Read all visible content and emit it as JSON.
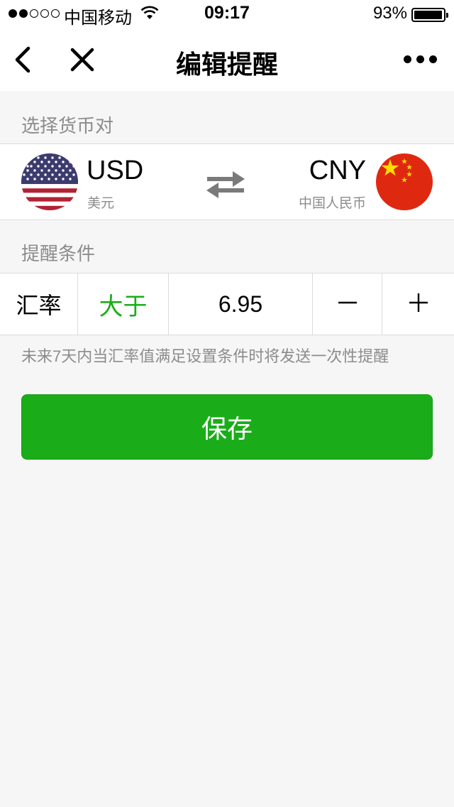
{
  "status_bar": {
    "carrier": "中国移动",
    "time": "09:17",
    "battery": "93%",
    "battery_level": 0.93,
    "signal_bars": 2,
    "signal_total": 5
  },
  "nav": {
    "title": "编辑提醒",
    "back_icon": "chevron-left-icon",
    "close_icon": "close-icon",
    "more_icon": "more-dots-icon"
  },
  "pair_section": {
    "label": "选择货币对",
    "from": {
      "code": "USD",
      "name": "美元",
      "flag_icon": "us-flag-icon"
    },
    "to": {
      "code": "CNY",
      "name": "中国人民币",
      "flag_icon": "china-flag-icon"
    },
    "swap_icon": "swap-arrows-icon"
  },
  "condition_section": {
    "label": "提醒条件",
    "metric": "汇率",
    "operator": "大于",
    "value": "6.95",
    "decrement_icon": "minus-icon",
    "increment_icon": "plus-icon"
  },
  "hint": "未来7天内当汇率值满足设置条件时将发送一次性提醒",
  "save_label": "保存",
  "colors": {
    "accent": "#1aad19",
    "background": "#f6f6f6",
    "muted_text": "#8c8c8c"
  }
}
